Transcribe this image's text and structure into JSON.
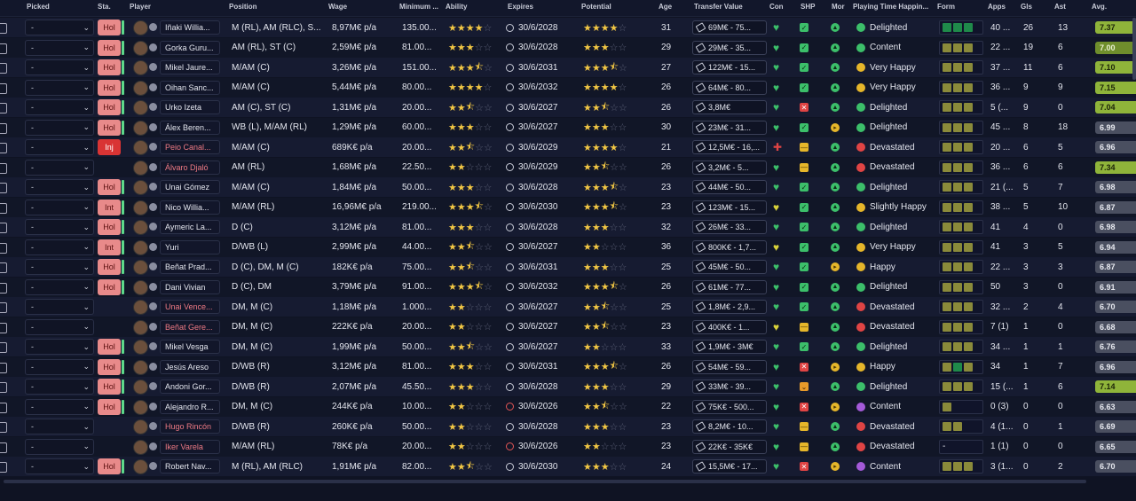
{
  "headers": {
    "picked": "Picked",
    "sta": "Sta.",
    "player": "Player",
    "position": "Position",
    "wage": "Wage",
    "min_fee": "Minimum ...",
    "ability": "Ability",
    "expires": "Expires",
    "potential": "Potential",
    "age": "Age",
    "transfer_value": "Transfer Value",
    "con": "Con",
    "shp": "SHP",
    "mor": "Mor",
    "playing_time": "Playing Time Happin...",
    "form": "Form",
    "apps": "Apps",
    "gls": "Gls",
    "ast": "Ast",
    "avg": "Avg."
  },
  "colors": {
    "accent_green": "#3cbf6a",
    "status_red": "#e88a8a",
    "injury_red": "#d93434",
    "star": "#f2c744"
  },
  "rows": [
    {
      "picked": "-",
      "sta": "Hol",
      "name": "Iñaki Willia...",
      "name_red": false,
      "position": "M (RL), AM (RLC), S...",
      "wage": "8,97M€ p/a",
      "min_fee": "135.00...",
      "ability": 4,
      "expires": "30/6/2028",
      "exp_red": false,
      "potential": 4,
      "age": "31",
      "tv": "69M€ - 75...",
      "con": "green",
      "shp": "ok",
      "mor": "g",
      "pt": "Delighted",
      "pt_color": "#3cbf6a",
      "form": [
        "#1f8a4a",
        "#1f8a4a",
        "#1f8a4a"
      ],
      "apps": "40 ...",
      "gls": "26",
      "ast": "13",
      "avg": "7.37",
      "avg_cls": "hi"
    },
    {
      "picked": "-",
      "sta": "Hol",
      "name": "Gorka Guru...",
      "name_red": false,
      "position": "AM (RL), ST (C)",
      "wage": "2,59M€ p/a",
      "min_fee": "81.00...",
      "ability": 3,
      "expires": "30/6/2028",
      "exp_red": false,
      "potential": 3,
      "age": "29",
      "tv": "29M€ - 35...",
      "con": "green",
      "shp": "ok",
      "mor": "g",
      "pt": "Content",
      "pt_color": "#3cbf6a",
      "form": [
        "#8a8a3a",
        "#8a8a3a",
        "#8a8a3a"
      ],
      "apps": "22 ...",
      "gls": "19",
      "ast": "6",
      "avg": "7.00",
      "avg_cls": "top"
    },
    {
      "picked": "-",
      "sta": "Hol",
      "name": "Mikel Jaure...",
      "name_red": false,
      "position": "M/AM (C)",
      "wage": "3,26M€ p/a",
      "min_fee": "151.00...",
      "ability": 3.5,
      "expires": "30/6/2031",
      "exp_red": false,
      "potential": 3.5,
      "age": "27",
      "tv": "122M€ - 15...",
      "con": "green",
      "shp": "ok",
      "mor": "g",
      "pt": "Very Happy",
      "pt_color": "#e6b62a",
      "form": [
        "#8a8a3a",
        "#8a8a3a",
        "#8a8a3a"
      ],
      "apps": "37 ...",
      "gls": "11",
      "ast": "6",
      "avg": "7.10",
      "avg_cls": "hi"
    },
    {
      "picked": "-",
      "sta": "Hol",
      "name": "Oihan Sanc...",
      "name_red": false,
      "position": "M/AM (C)",
      "wage": "5,44M€ p/a",
      "min_fee": "80.00...",
      "ability": 4,
      "expires": "30/6/2032",
      "exp_red": false,
      "potential": 4,
      "age": "26",
      "tv": "64M€ - 80...",
      "con": "green",
      "shp": "ok",
      "mor": "g",
      "pt": "Very Happy",
      "pt_color": "#e6b62a",
      "form": [
        "#8a8a3a",
        "#8a8a3a",
        "#8a8a3a"
      ],
      "apps": "36 ...",
      "gls": "9",
      "ast": "9",
      "avg": "7.15",
      "avg_cls": "hi"
    },
    {
      "picked": "-",
      "sta": "Hol",
      "name": "Urko Izeta",
      "name_red": false,
      "position": "AM (C), ST (C)",
      "wage": "1,31M€ p/a",
      "min_fee": "20.00...",
      "ability": 2.5,
      "expires": "30/6/2027",
      "exp_red": false,
      "potential": 2.5,
      "age": "26",
      "tv": "3,8M€",
      "con": "green",
      "shp": "x",
      "mor": "g",
      "pt": "Delighted",
      "pt_color": "#3cbf6a",
      "form": [
        "#8a8a3a",
        "#8a8a3a",
        "#8a8a3a"
      ],
      "apps": "5 (...",
      "gls": "9",
      "ast": "0",
      "avg": "7.04",
      "avg_cls": "hi"
    },
    {
      "picked": "-",
      "sta": "Hol",
      "name": "Álex Beren...",
      "name_red": false,
      "position": "WB (L), M/AM (RL)",
      "wage": "1,29M€ p/a",
      "min_fee": "60.00...",
      "ability": 3,
      "expires": "30/6/2027",
      "exp_red": false,
      "potential": 3,
      "age": "30",
      "tv": "23M€ - 31...",
      "con": "green",
      "shp": "ok",
      "mor": "y",
      "pt": "Delighted",
      "pt_color": "#3cbf6a",
      "form": [
        "#8a8a3a",
        "#8a8a3a",
        "#8a8a3a"
      ],
      "apps": "45 ...",
      "gls": "8",
      "ast": "18",
      "avg": "6.99",
      "avg_cls": "mid"
    },
    {
      "picked": "-",
      "sta": "Inj",
      "name": "Peio Canal...",
      "name_red": true,
      "position": "M/AM (C)",
      "wage": "689K€ p/a",
      "min_fee": "20.00...",
      "ability": 2.5,
      "expires": "30/6/2029",
      "exp_red": false,
      "potential": 4,
      "age": "21",
      "tv": "12,5M€ - 16,...",
      "con": "red",
      "shp": "m",
      "mor": "g",
      "pt": "Devastated",
      "pt_color": "#e04444",
      "form": [
        "#8a8a3a",
        "#8a8a3a",
        "#8a8a3a"
      ],
      "apps": "20 ...",
      "gls": "6",
      "ast": "5",
      "avg": "6.96",
      "avg_cls": "mid"
    },
    {
      "picked": "-",
      "sta": "",
      "name": "Álvaro Djaló",
      "name_red": true,
      "position": "AM (RL)",
      "wage": "1,68M€ p/a",
      "min_fee": "22.50...",
      "ability": 2,
      "expires": "30/6/2029",
      "exp_red": false,
      "potential": 2.5,
      "age": "26",
      "tv": "3,2M€ - 5...",
      "con": "green",
      "shp": "m",
      "mor": "g",
      "pt": "Devastated",
      "pt_color": "#e04444",
      "form": [
        "#8a8a3a",
        "#8a8a3a",
        "#8a8a3a"
      ],
      "apps": "36 ...",
      "gls": "6",
      "ast": "6",
      "avg": "7.34",
      "avg_cls": "hi"
    },
    {
      "picked": "-",
      "sta": "Hol",
      "name": "Unai Gómez",
      "name_red": false,
      "position": "M/AM (C)",
      "wage": "1,84M€ p/a",
      "min_fee": "50.00...",
      "ability": 3,
      "expires": "30/6/2028",
      "exp_red": false,
      "potential": 3.5,
      "age": "23",
      "tv": "44M€ - 50...",
      "con": "green",
      "shp": "ok",
      "mor": "g",
      "pt": "Delighted",
      "pt_color": "#3cbf6a",
      "form": [
        "#8a8a3a",
        "#8a8a3a",
        "#8a8a3a"
      ],
      "apps": "21 (...",
      "gls": "5",
      "ast": "7",
      "avg": "6.98",
      "avg_cls": "mid"
    },
    {
      "picked": "-",
      "sta": "Int",
      "name": "Nico Willia...",
      "name_red": false,
      "position": "M/AM (RL)",
      "wage": "16,96M€ p/a",
      "min_fee": "219.00...",
      "ability": 3.5,
      "expires": "30/6/2030",
      "exp_red": false,
      "potential": 3.5,
      "age": "23",
      "tv": "123M€ - 15...",
      "con": "yellow",
      "shp": "ok",
      "mor": "g",
      "pt": "Slightly Happy",
      "pt_color": "#e6b62a",
      "form": [
        "#8a8a3a",
        "#8a8a3a",
        "#8a8a3a"
      ],
      "apps": "38 ...",
      "gls": "5",
      "ast": "10",
      "avg": "6.87",
      "avg_cls": "mid"
    },
    {
      "picked": "-",
      "sta": "Hol",
      "name": "Aymeric La...",
      "name_red": false,
      "position": "D (C)",
      "wage": "3,12M€ p/a",
      "min_fee": "81.00...",
      "ability": 3,
      "expires": "30/6/2028",
      "exp_red": false,
      "potential": 3,
      "age": "32",
      "tv": "26M€ - 33...",
      "con": "green",
      "shp": "ok",
      "mor": "g",
      "pt": "Delighted",
      "pt_color": "#3cbf6a",
      "form": [
        "#8a8a3a",
        "#8a8a3a",
        "#8a8a3a"
      ],
      "apps": "41",
      "gls": "4",
      "ast": "0",
      "avg": "6.98",
      "avg_cls": "mid"
    },
    {
      "picked": "-",
      "sta": "Int",
      "name": "Yuri",
      "name_red": false,
      "position": "D/WB (L)",
      "wage": "2,99M€ p/a",
      "min_fee": "44.00...",
      "ability": 2.5,
      "expires": "30/6/2027",
      "exp_red": false,
      "potential": 2,
      "age": "36",
      "tv": "800K€ - 1,7...",
      "con": "yellow",
      "shp": "ok",
      "mor": "g",
      "pt": "Very Happy",
      "pt_color": "#e6b62a",
      "form": [
        "#8a8a3a",
        "#8a8a3a",
        "#8a8a3a"
      ],
      "apps": "41",
      "gls": "3",
      "ast": "5",
      "avg": "6.94",
      "avg_cls": "mid"
    },
    {
      "picked": "-",
      "sta": "Hol",
      "name": "Beñat Prad...",
      "name_red": false,
      "position": "D (C), DM, M (C)",
      "wage": "182K€ p/a",
      "min_fee": "75.00...",
      "ability": 2.5,
      "expires": "30/6/2031",
      "exp_red": false,
      "potential": 3,
      "age": "25",
      "tv": "45M€ - 50...",
      "con": "green",
      "shp": "ok",
      "mor": "y",
      "pt": "Happy",
      "pt_color": "#e6b62a",
      "form": [
        "#8a8a3a",
        "#8a8a3a",
        "#8a8a3a"
      ],
      "apps": "22 ...",
      "gls": "3",
      "ast": "3",
      "avg": "6.87",
      "avg_cls": "mid"
    },
    {
      "picked": "-",
      "sta": "Hol",
      "name": "Dani Vivian",
      "name_red": false,
      "position": "D (C), DM",
      "wage": "3,79M€ p/a",
      "min_fee": "91.00...",
      "ability": 3.5,
      "expires": "30/6/2032",
      "exp_red": false,
      "potential": 3.5,
      "age": "26",
      "tv": "61M€ - 77...",
      "con": "green",
      "shp": "ok",
      "mor": "g",
      "pt": "Delighted",
      "pt_color": "#3cbf6a",
      "form": [
        "#8a8a3a",
        "#8a8a3a",
        "#8a8a3a"
      ],
      "apps": "50",
      "gls": "3",
      "ast": "0",
      "avg": "6.91",
      "avg_cls": "mid"
    },
    {
      "picked": "-",
      "sta": "",
      "name": "Unai Vence...",
      "name_red": true,
      "position": "DM, M (C)",
      "wage": "1,18M€ p/a",
      "min_fee": "1.000...",
      "ability": 2,
      "expires": "30/6/2027",
      "exp_red": false,
      "potential": 2.5,
      "age": "25",
      "tv": "1,8M€ - 2,9...",
      "con": "green",
      "shp": "ok",
      "mor": "g",
      "pt": "Devastated",
      "pt_color": "#e04444",
      "form": [
        "#8a8a3a",
        "#8a8a3a",
        "#8a8a3a"
      ],
      "apps": "32 ...",
      "gls": "2",
      "ast": "4",
      "avg": "6.70",
      "avg_cls": "mid"
    },
    {
      "picked": "-",
      "sta": "",
      "name": "Beñat Gere...",
      "name_red": true,
      "position": "DM, M (C)",
      "wage": "222K€ p/a",
      "min_fee": "20.00...",
      "ability": 2,
      "expires": "30/6/2027",
      "exp_red": false,
      "potential": 2.5,
      "age": "23",
      "tv": "400K€ - 1...",
      "con": "yellow",
      "shp": "m",
      "mor": "g",
      "pt": "Devastated",
      "pt_color": "#e04444",
      "form": [
        "#8a8a3a",
        "#8a8a3a",
        "#8a8a3a"
      ],
      "apps": "7 (1)",
      "gls": "1",
      "ast": "0",
      "avg": "6.68",
      "avg_cls": "mid"
    },
    {
      "picked": "-",
      "sta": "Hol",
      "name": "Mikel Vesga",
      "name_red": false,
      "position": "DM, M (C)",
      "wage": "1,99M€ p/a",
      "min_fee": "50.00...",
      "ability": 2.5,
      "expires": "30/6/2027",
      "exp_red": false,
      "potential": 2,
      "age": "33",
      "tv": "1,9M€ - 3M€",
      "con": "green",
      "shp": "ok",
      "mor": "g",
      "pt": "Delighted",
      "pt_color": "#3cbf6a",
      "form": [
        "#8a8a3a",
        "#8a8a3a",
        "#8a8a3a"
      ],
      "apps": "34 ...",
      "gls": "1",
      "ast": "1",
      "avg": "6.76",
      "avg_cls": "mid"
    },
    {
      "picked": "-",
      "sta": "Hol",
      "name": "Jesús Areso",
      "name_red": false,
      "position": "D/WB (R)",
      "wage": "3,12M€ p/a",
      "min_fee": "81.00...",
      "ability": 3,
      "expires": "30/6/2031",
      "exp_red": false,
      "potential": 3.5,
      "age": "26",
      "tv": "54M€ - 59...",
      "con": "green",
      "shp": "x",
      "mor": "y",
      "pt": "Happy",
      "pt_color": "#e6b62a",
      "form": [
        "#8a8a3a",
        "#1f8a4a",
        "#8a8a3a"
      ],
      "apps": "34",
      "gls": "1",
      "ast": "7",
      "avg": "6.96",
      "avg_cls": "mid"
    },
    {
      "picked": "-",
      "sta": "Hol",
      "name": "Andoni Gor...",
      "name_red": false,
      "position": "D/WB (R)",
      "wage": "2,07M€ p/a",
      "min_fee": "45.50...",
      "ability": 3,
      "expires": "30/6/2028",
      "exp_red": false,
      "potential": 3,
      "age": "29",
      "tv": "33M€ - 39...",
      "con": "green",
      "shp": "v",
      "mor": "g",
      "pt": "Delighted",
      "pt_color": "#3cbf6a",
      "form": [
        "#8a8a3a",
        "#8a8a3a",
        "#8a8a3a"
      ],
      "apps": "15 (...",
      "gls": "1",
      "ast": "6",
      "avg": "7.14",
      "avg_cls": "hi"
    },
    {
      "picked": "-",
      "sta": "Hol",
      "name": "Alejandro R...",
      "name_red": false,
      "position": "DM, M (C)",
      "wage": "244K€ p/a",
      "min_fee": "10.00...",
      "ability": 2,
      "expires": "30/6/2026",
      "exp_red": true,
      "potential": 2.5,
      "age": "22",
      "tv": "75K€ - 500...",
      "con": "green",
      "shp": "x",
      "mor": "y",
      "pt": "Content",
      "pt_color": "#a45ad9",
      "form": [
        "#8a8a3a"
      ],
      "apps": "0 (3)",
      "gls": "0",
      "ast": "0",
      "avg": "6.63",
      "avg_cls": "mid"
    },
    {
      "picked": "-",
      "sta": "",
      "name": "Hugo Rincón",
      "name_red": true,
      "position": "D/WB (R)",
      "wage": "260K€ p/a",
      "min_fee": "50.00...",
      "ability": 2,
      "expires": "30/6/2028",
      "exp_red": false,
      "potential": 3,
      "age": "23",
      "tv": "8,2M€ - 10...",
      "con": "green",
      "shp": "m",
      "mor": "g",
      "pt": "Devastated",
      "pt_color": "#e04444",
      "form": [
        "#8a8a3a",
        "#8a8a3a"
      ],
      "apps": "4 (1...",
      "gls": "0",
      "ast": "1",
      "avg": "6.69",
      "avg_cls": "mid"
    },
    {
      "picked": "-",
      "sta": "",
      "name": "Iker Varela",
      "name_red": true,
      "position": "M/AM (RL)",
      "wage": "78K€ p/a",
      "min_fee": "20.00...",
      "ability": 2,
      "expires": "30/6/2026",
      "exp_red": true,
      "potential": 2,
      "age": "23",
      "tv": "22K€ - 35K€",
      "con": "green",
      "shp": "m",
      "mor": "g",
      "pt": "Devastated",
      "pt_color": "#e04444",
      "form": [],
      "form_text": "-",
      "apps": "1 (1)",
      "gls": "0",
      "ast": "0",
      "avg": "6.65",
      "avg_cls": "mid"
    },
    {
      "picked": "-",
      "sta": "Hol",
      "name": "Robert Nav...",
      "name_red": false,
      "position": "M (RL), AM (RLC)",
      "wage": "1,91M€ p/a",
      "min_fee": "82.00...",
      "ability": 2.5,
      "expires": "30/6/2030",
      "exp_red": false,
      "potential": 3,
      "age": "24",
      "tv": "15,5M€ - 17...",
      "con": "green",
      "shp": "x",
      "mor": "y",
      "pt": "Content",
      "pt_color": "#a45ad9",
      "form": [
        "#8a8a3a",
        "#8a8a3a",
        "#8a8a3a"
      ],
      "apps": "3 (1...",
      "gls": "0",
      "ast": "2",
      "avg": "6.70",
      "avg_cls": "mid"
    }
  ]
}
